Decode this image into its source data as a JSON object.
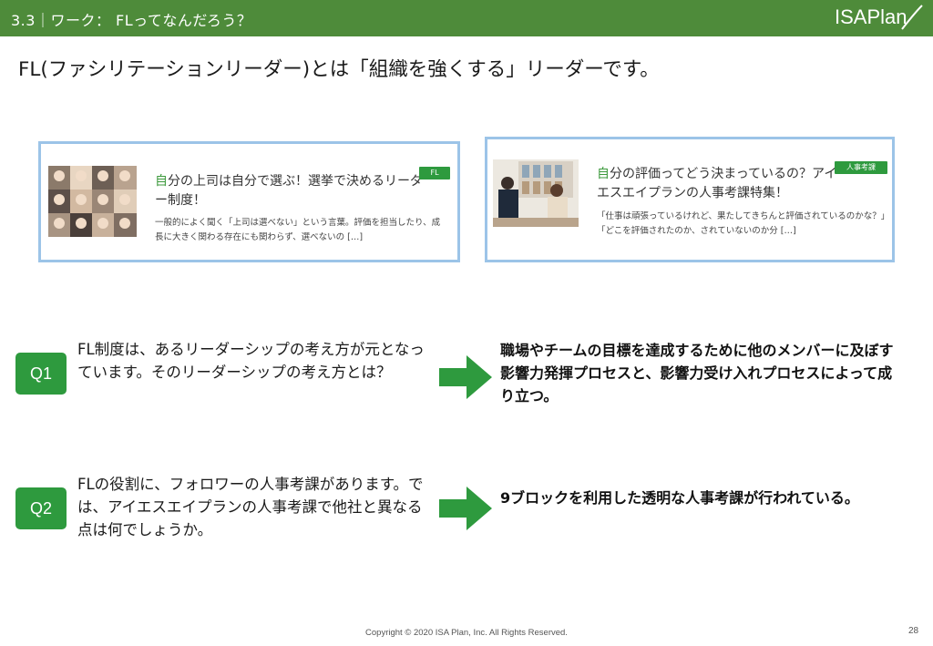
{
  "header": {
    "section": "3.3｜ワーク： FLってなんだろう？",
    "logo": "ISAPlan"
  },
  "title": "FL(ファシリテーションリーダー)とは「組織を強くする」リーダーです。",
  "cards": [
    {
      "headline_accent": "自",
      "headline_rest": "分の上司は自分で選ぶ！選挙で決めるリーダー制度！",
      "summary": "一般的によく聞く「上司は選べない」という言葉。評価を担当したり、成長に大きく関わる存在にも関わらず、選べないの […]",
      "tag": "FL"
    },
    {
      "headline_accent": "自",
      "headline_rest": "分の評価ってどう決まっているの？アイエスエイプランの人事考課特集！",
      "summary": "「仕事は頑張っているけれど、果たしてきちんと評価されているのかな？」「どこを評価されたのか、されていないのか分 […]",
      "tag": "人事考課"
    }
  ],
  "questions": [
    {
      "label": "Q1",
      "text": "FL制度は、あるリーダーシップの考え方が元となっています。そのリーダーシップの考え方とは？",
      "answer": "職場やチームの目標を達成するために他のメンバーに及ぼす影響力発揮プロセスと、影響力受け入れプロセスによって成り立つ。"
    },
    {
      "label": "Q2",
      "text": "FLの役割に、フォロワーの人事考課があります。では、アイエスエイプランの人事考課で他社と異なる点は何でしょうか。",
      "answer": "9ブロックを利用した透明な人事考課が行われている。"
    }
  ],
  "footer": {
    "copyright": "Copyright © 2020 ISA Plan, Inc. All Rights Reserved.",
    "page_number": "28"
  },
  "colors": {
    "header_green": "#4e8b3a",
    "accent_green": "#2e9a3e",
    "card_border": "#9cc4e8"
  }
}
